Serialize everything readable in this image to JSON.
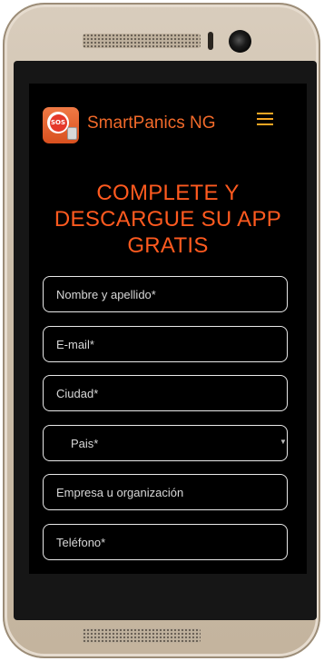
{
  "header": {
    "logo_text": "SOS",
    "brand": "SmartPanics NG"
  },
  "heading": {
    "line1": "COMPLETE Y",
    "line2": "DESCARGUE SU APP",
    "line3": "GRATIS"
  },
  "form": {
    "name_placeholder": "Nombre y apellido*",
    "email_placeholder": "E-mail*",
    "city_placeholder": "Ciudad*",
    "country_selected": "Pais*",
    "company_placeholder": "Empresa u organización",
    "phone_placeholder": "Teléfono*"
  },
  "colors": {
    "accent": "#f26a2a",
    "heading": "#ff5a1f",
    "menu": "#f5a623"
  }
}
